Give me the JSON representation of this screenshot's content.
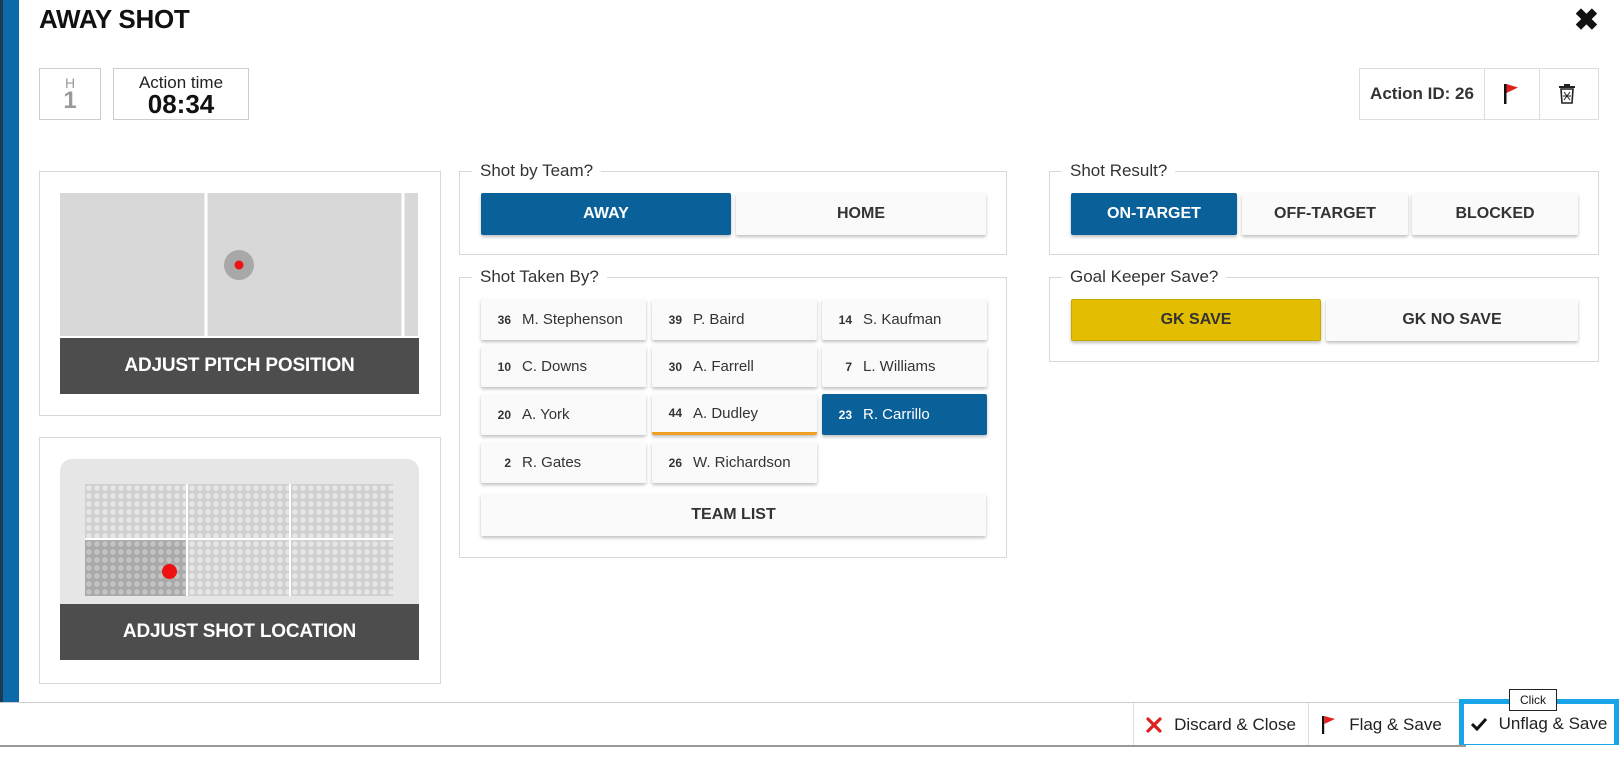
{
  "header": {
    "title": "AWAY SHOT",
    "close_icon": "✖",
    "half_label": "H",
    "half_value": "1",
    "action_time_label": "Action time",
    "action_time_value": "08:34",
    "action_id": "Action ID: 26",
    "flag_icon": "flag-icon",
    "delete_icon": "trash-icon"
  },
  "pitch": {
    "adjust_label": "ADJUST PITCH POSITION"
  },
  "goal": {
    "adjust_label": "ADJUST SHOT LOCATION"
  },
  "shot_by_team": {
    "legend": "Shot by Team?",
    "options": [
      "AWAY",
      "HOME"
    ],
    "selected": "AWAY"
  },
  "shot_taken_by": {
    "legend": "Shot Taken By?",
    "players": [
      {
        "num": "36",
        "name": "M. Stephenson"
      },
      {
        "num": "39",
        "name": "P. Baird"
      },
      {
        "num": "14",
        "name": "S. Kaufman"
      },
      {
        "num": "10",
        "name": "C. Downs"
      },
      {
        "num": "30",
        "name": "A. Farrell"
      },
      {
        "num": "7",
        "name": "L. Williams"
      },
      {
        "num": "20",
        "name": "A. York"
      },
      {
        "num": "44",
        "name": "A. Dudley"
      },
      {
        "num": "23",
        "name": "R. Carrillo"
      },
      {
        "num": "2",
        "name": "R. Gates"
      },
      {
        "num": "26",
        "name": "W. Richardson"
      }
    ],
    "selected": "R. Carrillo",
    "team_list_label": "TEAM LIST"
  },
  "shot_result": {
    "legend": "Shot Result?",
    "options": [
      "ON-TARGET",
      "OFF-TARGET",
      "BLOCKED"
    ],
    "selected": "ON-TARGET"
  },
  "gk_save": {
    "legend": "Goal Keeper Save?",
    "options": [
      "GK SAVE",
      "GK NO SAVE"
    ],
    "selected": "GK SAVE"
  },
  "footer": {
    "discard_label": "Discard & Close",
    "flag_save_label": "Flag & Save",
    "unflag_save_label": "Unflag & Save",
    "tooltip": "Click"
  },
  "colors": {
    "accent": "#0a6199",
    "gk_yellow": "#e2bd00",
    "focus_outline": "#19a4e8",
    "danger": "#e0201e"
  }
}
